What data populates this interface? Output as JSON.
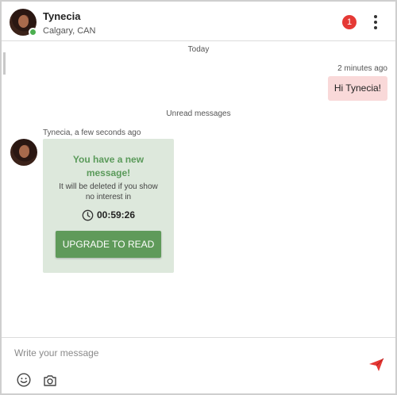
{
  "header": {
    "contact_name": "Tynecia",
    "location": "Calgary, CAN",
    "unread_badge": "1",
    "menu_icon": "more-vertical-icon"
  },
  "conversation": {
    "divider_today": "Today",
    "sent_time": "2 minutes ago",
    "sent_message": "Hi Tynecia!",
    "divider_unread": "Unread messages",
    "received_meta": "Tynecia,  a few seconds ago",
    "locked_card": {
      "title_line1": "You have a new",
      "title_line2": "message!",
      "subtitle_line1": "It will be deleted if you show",
      "subtitle_line2": "no interest in",
      "timer": "00:59:26",
      "button_label": "UPGRADE TO READ"
    }
  },
  "composer": {
    "placeholder": "Write your message",
    "value": "",
    "icons": [
      "emoji-icon",
      "camera-icon",
      "send-icon"
    ]
  },
  "colors": {
    "online": "#4caf50",
    "badge": "#e53935",
    "sent_bubble": "#f9d9d9",
    "card_bg": "#dde8dc",
    "card_title": "#5a9a5a",
    "button": "#5f9a5a",
    "send": "#e53935"
  }
}
